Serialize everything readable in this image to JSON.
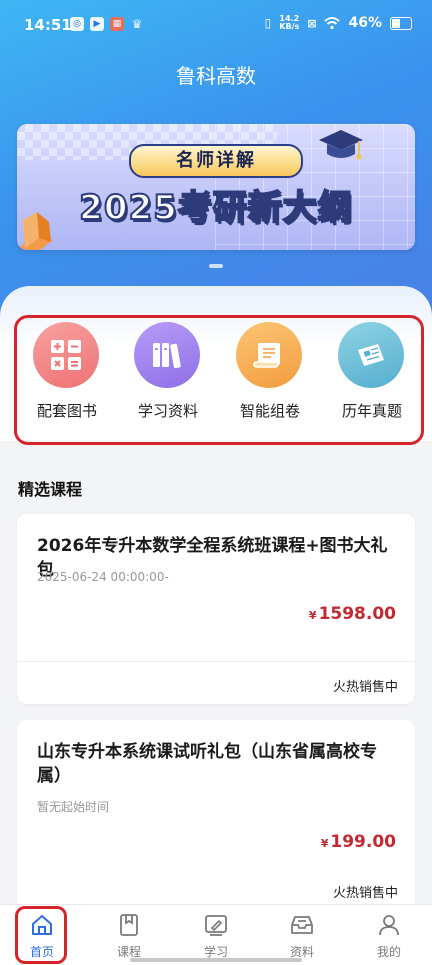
{
  "status_bar": {
    "time": "14:51",
    "net_speed_value": "14.2",
    "net_speed_unit": "KB/s",
    "battery": "46%"
  },
  "app": {
    "title": "鲁科高数"
  },
  "banner": {
    "badge": "名师详解",
    "heading": "2025考研新大纲"
  },
  "quick_nav": [
    {
      "label": "配套图书",
      "icon": "calculator-icon",
      "color": "#f28b8d"
    },
    {
      "label": "学习资料",
      "icon": "books-icon",
      "color": "#a78bf0"
    },
    {
      "label": "智能组卷",
      "icon": "scroll-icon",
      "color": "#f5b05a"
    },
    {
      "label": "历年真题",
      "icon": "newspaper-icon",
      "color": "#6cc2d9"
    }
  ],
  "featured": {
    "title": "精选课程",
    "courses": [
      {
        "title": "2026年专升本数学全程系统班课程+图书大礼包",
        "date": "2025-06-24 00:00:00-",
        "currency": "¥",
        "price": "1598.00",
        "status": "火热销售中"
      },
      {
        "title": "山东专升本系统课试听礼包（山东省属高校专属）",
        "date": "暂无起始时间",
        "currency": "¥",
        "price": "199.00",
        "status": "火热销售中"
      }
    ]
  },
  "tabbar": [
    {
      "label": "首页",
      "icon": "home-icon",
      "active": true
    },
    {
      "label": "课程",
      "icon": "bookmark-book-icon",
      "active": false
    },
    {
      "label": "学习",
      "icon": "pencil-board-icon",
      "active": false
    },
    {
      "label": "资料",
      "icon": "inbox-tray-icon",
      "active": false
    },
    {
      "label": "我的",
      "icon": "user-icon",
      "active": false
    }
  ],
  "colors": {
    "accent": "#2f6fe0",
    "price": "#c32933",
    "highlight": "#d5252a"
  }
}
